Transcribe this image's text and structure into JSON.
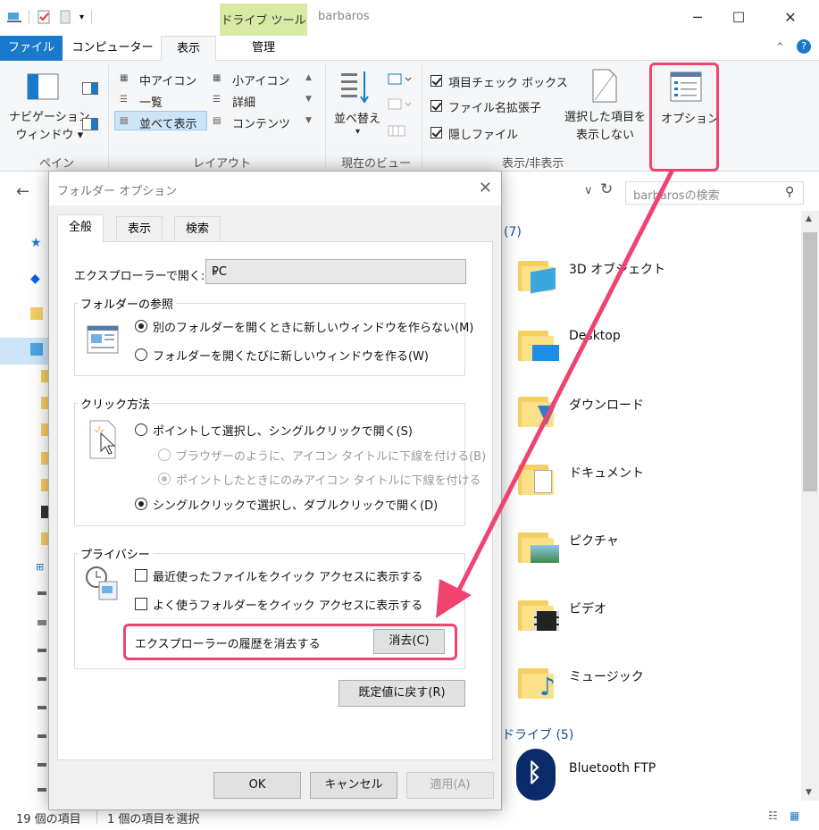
{
  "window": {
    "title": "barbaros",
    "context_tab": "ドライブ ツール"
  },
  "ribbon_tabs": [
    "ファイル",
    "コンピューター",
    "表示",
    "管理"
  ],
  "ribbon": {
    "pane_group": {
      "nav_pane_label": "ナビゲーション\nウィンドウ ▾",
      "group_label": "ペイン"
    },
    "layout_group": {
      "items": [
        "中アイコン",
        "小アイコン",
        "一覧",
        "詳細",
        "並べて表示",
        "コンテンツ"
      ],
      "selected": "並べて表示",
      "group_label": "レイアウト"
    },
    "current_view_group": {
      "sort_label": "並べ替え",
      "group_label": "現在のビュー"
    },
    "show_hide_group": {
      "checks": [
        "項目チェック ボックス",
        "ファイル名拡張子",
        "隠しファイル"
      ],
      "hide_selected": "選択した項目を\n表示しない",
      "group_label": "表示/非表示"
    },
    "options_label": "オプション"
  },
  "address": {
    "search_placeholder": "barbarosの検索"
  },
  "content": {
    "section_folders_count": "(7)",
    "folders": [
      "3D オブジェクト",
      "Desktop",
      "ダウンロード",
      "ドキュメント",
      "ピクチャ",
      "ビデオ",
      "ミュージック"
    ],
    "section_drives": "ドライブ (5)",
    "bluetooth": "Bluetooth FTP"
  },
  "status": {
    "count": "19 個の項目",
    "selected": "1 個の項目を選択"
  },
  "dialog": {
    "title": "フォルダー オプション",
    "tabs": [
      "全般",
      "表示",
      "検索"
    ],
    "open_label": "エクスプローラーで開く:",
    "open_value": "PC",
    "browse": {
      "legend": "フォルダーの参照",
      "opt1": "別のフォルダーを開くときに新しいウィンドウを作らない(M)",
      "opt2": "フォルダーを開くたびに新しいウィンドウを作る(W)"
    },
    "click": {
      "legend": "クリック方法",
      "opt1": "ポイントして選択し、シングルクリックで開く(S)",
      "sub1": "ブラウザーのように、アイコン タイトルに下線を付ける(B)",
      "sub2": "ポイントしたときにのみアイコン タイトルに下線を付ける",
      "opt2": "シングルクリックで選択し、ダブルクリックで開く(D)"
    },
    "privacy": {
      "legend": "プライバシー",
      "chk1": "最近使ったファイルをクイック アクセスに表示する",
      "chk2": "よく使うフォルダーをクイック アクセスに表示する",
      "clear_label": "エクスプローラーの履歴を消去する",
      "clear_button": "消去(C)"
    },
    "restore_button": "既定値に戻す(R)",
    "ok": "OK",
    "cancel": "キャンセル",
    "apply": "適用(A)"
  }
}
